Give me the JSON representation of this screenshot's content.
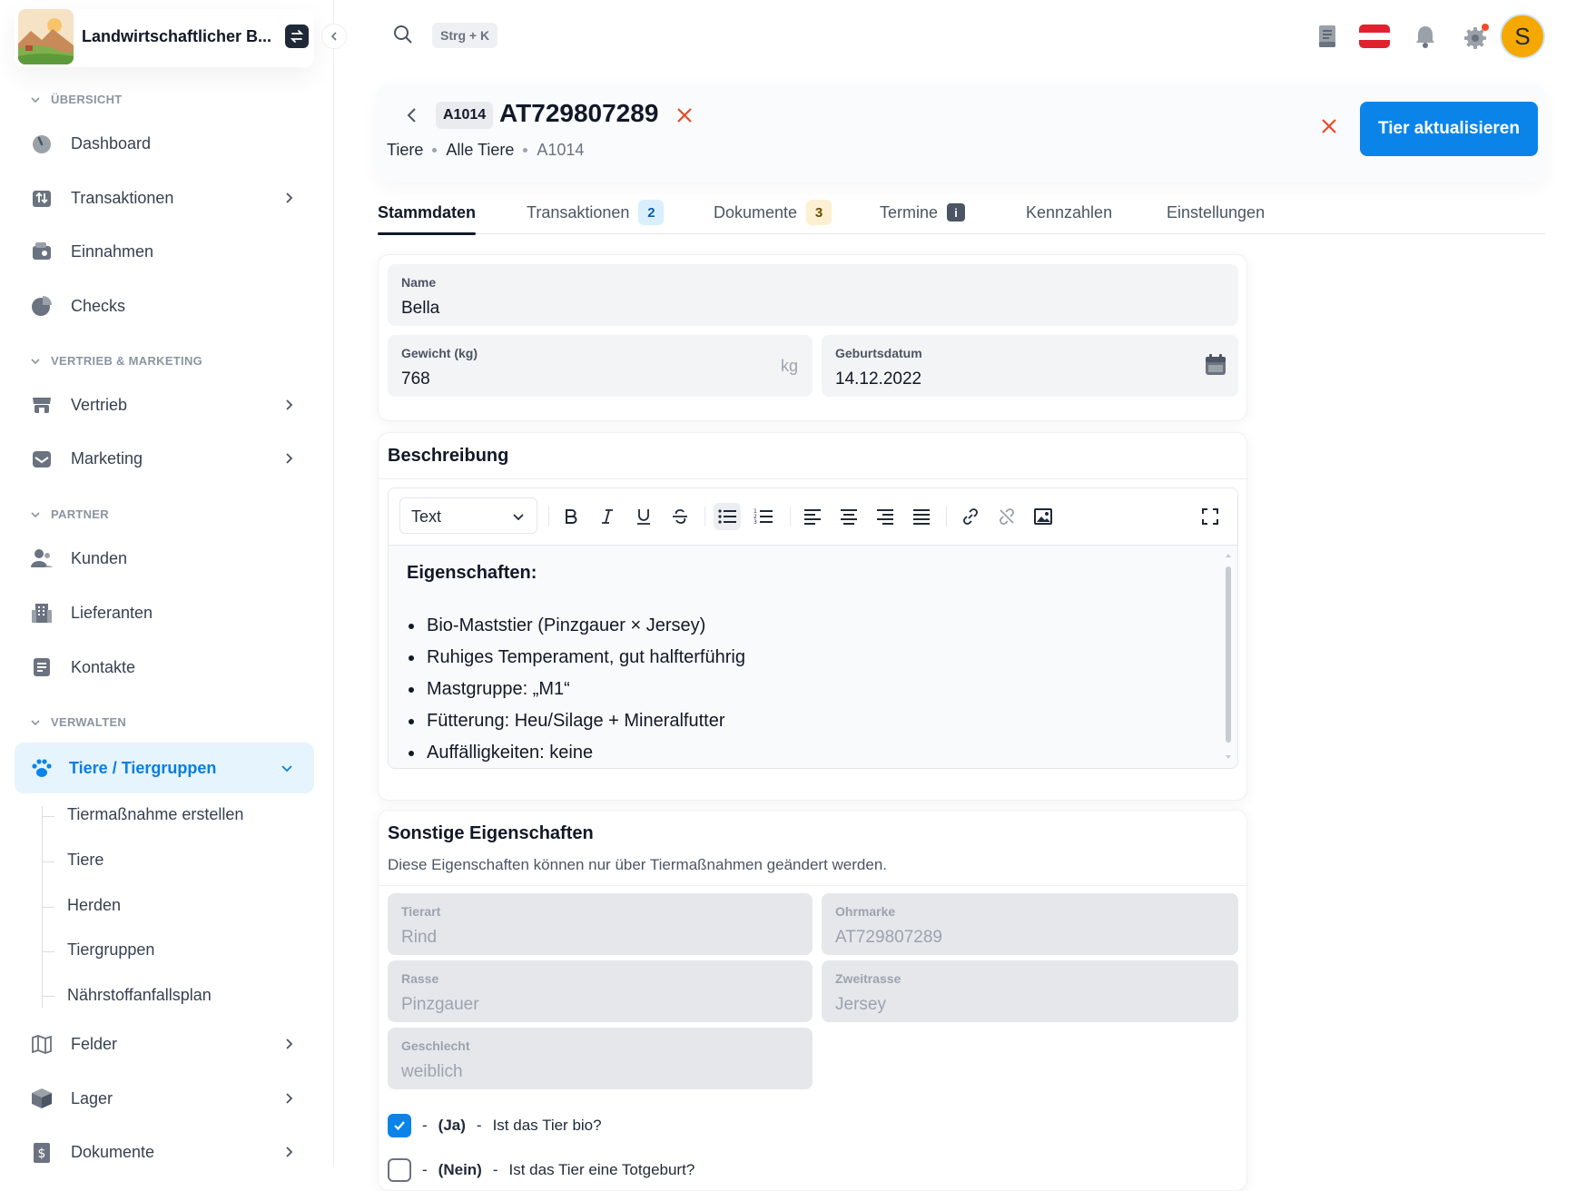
{
  "brand": {
    "name": "Landwirtschaftlicher B..."
  },
  "search": {
    "shortcut": "Strg + K"
  },
  "header": {
    "tag": "A1014",
    "title": "AT729807289",
    "breadcrumbs": [
      "Tiere",
      "Alle Tiere",
      "A1014"
    ],
    "update_label": "Tier aktualisieren"
  },
  "sidebar": {
    "sections": {
      "overview": "ÜBERSICHT",
      "sales": "VERTRIEB & MARKETING",
      "partner": "PARTNER",
      "manage": "VERWALTEN"
    },
    "items": [
      {
        "label": "Dashboard"
      },
      {
        "label": "Transaktionen"
      },
      {
        "label": "Einnahmen"
      },
      {
        "label": "Checks"
      },
      {
        "label": "Vertrieb"
      },
      {
        "label": "Marketing"
      },
      {
        "label": "Kunden"
      },
      {
        "label": "Lieferanten"
      },
      {
        "label": "Kontakte"
      },
      {
        "label": "Tiere / Tiergruppen"
      },
      {
        "label": "Felder"
      },
      {
        "label": "Lager"
      },
      {
        "label": "Dokumente"
      }
    ],
    "subitems": [
      "Tiermaßnahme erstellen",
      "Tiere",
      "Herden",
      "Tiergruppen",
      "Nährstoffanfallsplan"
    ]
  },
  "tabs": [
    {
      "label": "Stammdaten"
    },
    {
      "label": "Transaktionen",
      "badge": "2"
    },
    {
      "label": "Dokumente",
      "badge": "3"
    },
    {
      "label": "Termine",
      "badge": "i"
    },
    {
      "label": "Kennzahlen"
    },
    {
      "label": "Einstellungen"
    }
  ],
  "form": {
    "name": {
      "label": "Name",
      "value": "Bella"
    },
    "weight": {
      "label": "Gewicht (kg)",
      "value": "768",
      "unit": "kg"
    },
    "birthdate": {
      "label": "Geburtsdatum",
      "value": "14.12.2022"
    }
  },
  "description": {
    "title": "Beschreibung",
    "format": "Text",
    "heading": "Eigenschaften:",
    "bullets": [
      "Bio-Maststier (Pinzgauer × Jersey)",
      "Ruhiges Temperament, gut halfterführig",
      "Mastgruppe: „M1“",
      "Fütterung: Heu/Silage + Mineralfutter",
      "Auffälligkeiten: keine"
    ]
  },
  "other": {
    "title": "Sonstige Eigenschaften",
    "subtitle": "Diese Eigenschaften können nur über Tiermaßnahmen geändert werden.",
    "species": {
      "label": "Tierart",
      "value": "Rind"
    },
    "eartag": {
      "label": "Ohrmarke",
      "value": "AT729807289"
    },
    "breed": {
      "label": "Rasse",
      "value": "Pinzgauer"
    },
    "breed2": {
      "label": "Zweitrasse",
      "value": "Jersey"
    },
    "sex": {
      "label": "Geschlecht",
      "value": "weiblich"
    },
    "checks": [
      {
        "state": "(Ja)",
        "question": "Ist das Tier bio?",
        "checked": true
      },
      {
        "state": "(Nein)",
        "question": "Ist das Tier eine Totgeburt?",
        "checked": false
      }
    ]
  },
  "colors": {
    "accent": "#0a84e8",
    "danger": "#e8492b",
    "avatar": "#f5a800"
  },
  "user": {
    "initial": "S"
  }
}
